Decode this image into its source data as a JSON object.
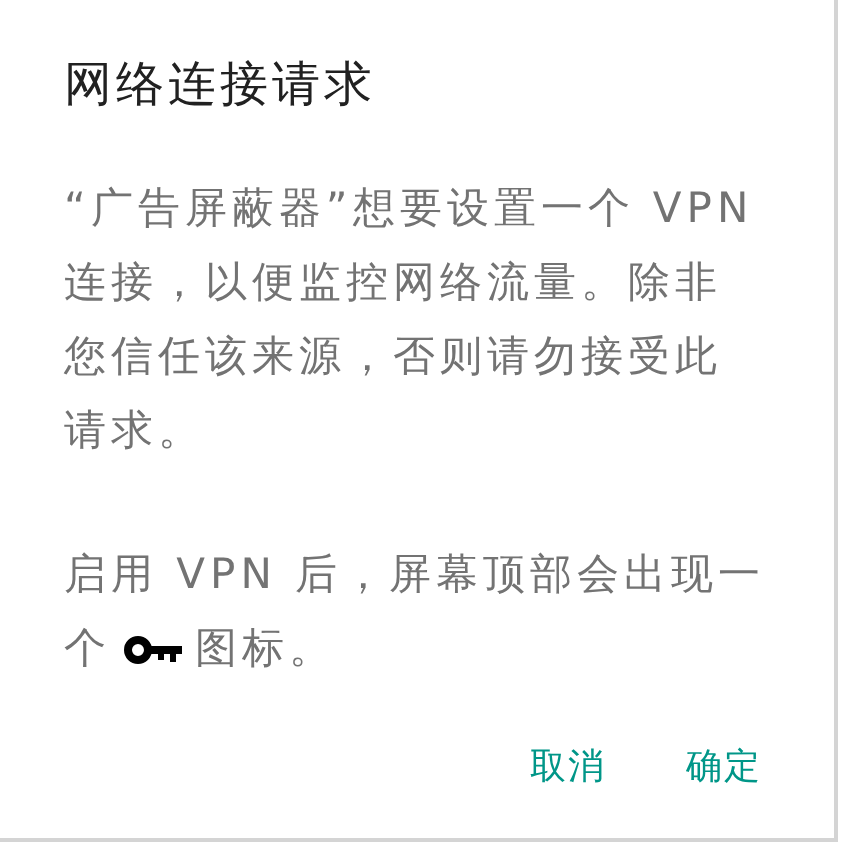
{
  "dialog": {
    "title": "网络连接请求",
    "message": "“广告屏蔽器”想要设置一个 VPN 连接，以便监控网络流量。除非您信任该来源，否则请勿接受此请求。",
    "notice": {
      "first_line": "启用 VPN 后，屏幕顶部会出现一",
      "before_icon": "个",
      "after_icon": "图标。"
    },
    "buttons": [
      "取消",
      "确定"
    ]
  }
}
